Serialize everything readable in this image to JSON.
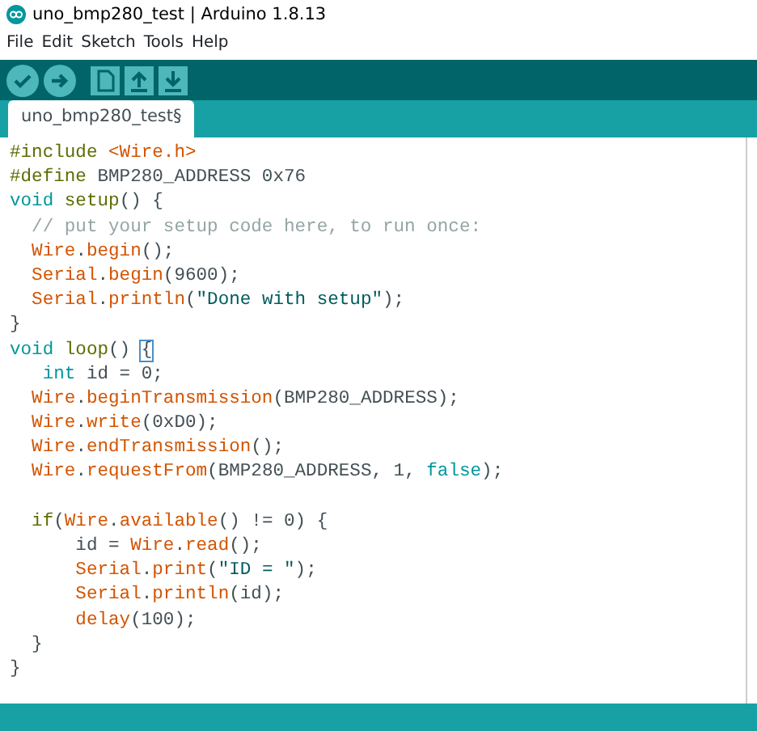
{
  "window": {
    "title": "uno_bmp280_test | Arduino 1.8.13"
  },
  "menu": [
    "File",
    "Edit",
    "Sketch",
    "Tools",
    "Help"
  ],
  "toolbar": [
    {
      "kind": "verify"
    },
    {
      "kind": "upload"
    },
    {
      "kind": "new"
    },
    {
      "kind": "open"
    },
    {
      "kind": "save"
    }
  ],
  "tabs": [
    {
      "label": "uno_bmp280_test§",
      "selected": true
    }
  ],
  "code_lines": [
    {
      "tokens": [
        {
          "kind": "directive",
          "text": "#include "
        },
        {
          "kind": "func",
          "text": "<Wire.h>"
        }
      ]
    },
    {
      "tokens": [
        {
          "kind": "directive",
          "text": "#define"
        },
        {
          "kind": "plain",
          "text": " BMP280_ADDRESS 0x76"
        }
      ]
    },
    {
      "tokens": [
        {
          "kind": "type",
          "text": "void "
        },
        {
          "kind": "directive",
          "text": "setup"
        },
        {
          "kind": "plain",
          "text": "() {"
        }
      ]
    },
    {
      "tokens": [
        {
          "kind": "comment",
          "text": "  // put your setup code here, to run once:"
        }
      ]
    },
    {
      "tokens": [
        {
          "kind": "func",
          "text": "  Wire"
        },
        {
          "kind": "plain",
          "text": "."
        },
        {
          "kind": "func",
          "text": "begin"
        },
        {
          "kind": "plain",
          "text": "();"
        }
      ]
    },
    {
      "tokens": [
        {
          "kind": "func",
          "text": "  Serial"
        },
        {
          "kind": "plain",
          "text": "."
        },
        {
          "kind": "func",
          "text": "begin"
        },
        {
          "kind": "plain",
          "text": "(9600);"
        }
      ]
    },
    {
      "tokens": [
        {
          "kind": "func",
          "text": "  Serial"
        },
        {
          "kind": "plain",
          "text": "."
        },
        {
          "kind": "func",
          "text": "println"
        },
        {
          "kind": "plain",
          "text": "("
        },
        {
          "kind": "string",
          "text": "\"Done with setup\""
        },
        {
          "kind": "plain",
          "text": ");"
        }
      ]
    },
    {
      "tokens": [
        {
          "kind": "plain",
          "text": "}"
        }
      ]
    },
    {
      "tokens": [
        {
          "kind": "type",
          "text": "void "
        },
        {
          "kind": "directive",
          "text": "loop"
        },
        {
          "kind": "plain",
          "text": "() "
        },
        {
          "kind": "bracket",
          "text": "{"
        }
      ]
    },
    {
      "tokens": [
        {
          "kind": "type",
          "text": "   int"
        },
        {
          "kind": "plain",
          "text": " id = 0;"
        }
      ]
    },
    {
      "tokens": [
        {
          "kind": "func",
          "text": "  Wire"
        },
        {
          "kind": "plain",
          "text": "."
        },
        {
          "kind": "func",
          "text": "beginTransmission"
        },
        {
          "kind": "plain",
          "text": "(BMP280_ADDRESS);"
        }
      ]
    },
    {
      "tokens": [
        {
          "kind": "func",
          "text": "  Wire"
        },
        {
          "kind": "plain",
          "text": "."
        },
        {
          "kind": "func",
          "text": "write"
        },
        {
          "kind": "plain",
          "text": "(0xD0);"
        }
      ]
    },
    {
      "tokens": [
        {
          "kind": "func",
          "text": "  Wire"
        },
        {
          "kind": "plain",
          "text": "."
        },
        {
          "kind": "func",
          "text": "endTransmission"
        },
        {
          "kind": "plain",
          "text": "();"
        }
      ]
    },
    {
      "tokens": [
        {
          "kind": "func",
          "text": "  Wire"
        },
        {
          "kind": "plain",
          "text": "."
        },
        {
          "kind": "func",
          "text": "requestFrom"
        },
        {
          "kind": "plain",
          "text": "(BMP280_ADDRESS, 1, "
        },
        {
          "kind": "type",
          "text": "false"
        },
        {
          "kind": "plain",
          "text": ");"
        }
      ]
    },
    {
      "blank_before": true,
      "tokens": [
        {
          "kind": "directive",
          "text": "  if"
        },
        {
          "kind": "plain",
          "text": "("
        },
        {
          "kind": "func",
          "text": "Wire"
        },
        {
          "kind": "plain",
          "text": "."
        },
        {
          "kind": "func",
          "text": "available"
        },
        {
          "kind": "plain",
          "text": "() != 0) {"
        }
      ]
    },
    {
      "tokens": [
        {
          "kind": "plain",
          "text": "      id = "
        },
        {
          "kind": "func",
          "text": "Wire"
        },
        {
          "kind": "plain",
          "text": "."
        },
        {
          "kind": "func",
          "text": "read"
        },
        {
          "kind": "plain",
          "text": "();"
        }
      ]
    },
    {
      "tokens": [
        {
          "kind": "func",
          "text": "      Serial"
        },
        {
          "kind": "plain",
          "text": "."
        },
        {
          "kind": "func",
          "text": "print"
        },
        {
          "kind": "plain",
          "text": "("
        },
        {
          "kind": "string",
          "text": "\"ID = \""
        },
        {
          "kind": "plain",
          "text": ");"
        }
      ]
    },
    {
      "tokens": [
        {
          "kind": "func",
          "text": "      Serial"
        },
        {
          "kind": "plain",
          "text": "."
        },
        {
          "kind": "func",
          "text": "println"
        },
        {
          "kind": "plain",
          "text": "(id);"
        }
      ]
    },
    {
      "tokens": [
        {
          "kind": "func",
          "text": "      delay"
        },
        {
          "kind": "plain",
          "text": "(100);"
        }
      ]
    },
    {
      "tokens": [
        {
          "kind": "plain",
          "text": "  }"
        }
      ]
    },
    {
      "tokens": [
        {
          "kind": "plain",
          "text": "}"
        }
      ]
    }
  ]
}
